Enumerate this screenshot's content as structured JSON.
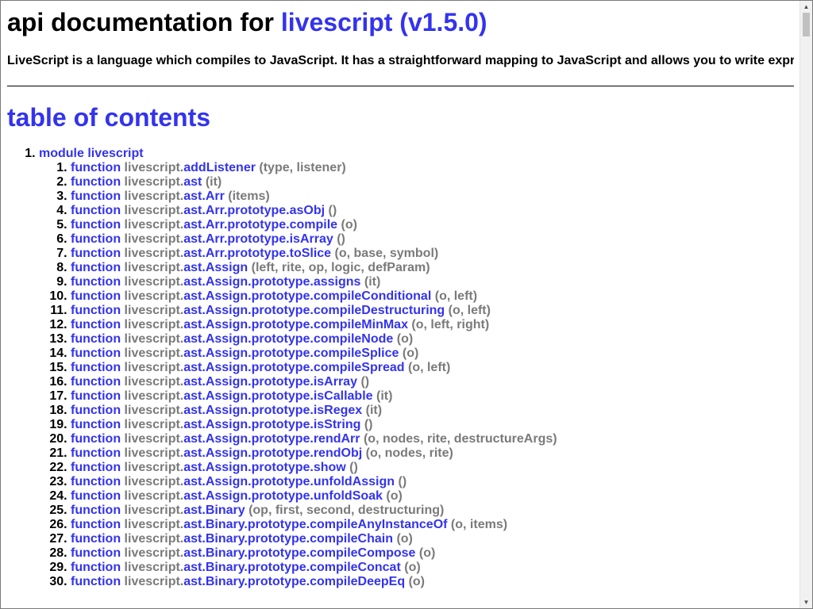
{
  "header": {
    "title_prefix": "api documentation for",
    "title_link": "livescript (v1.5.0)"
  },
  "intro": "LiveScript is a language which compiles to JavaScript. It has a straightforward mapping to JavaScript and allows you to write expressive code devoid of repetitive boilerplate. While LiveScript adds many features to assist in functional style programming,",
  "toc": {
    "heading": "table of contents",
    "module_label": "module livescript",
    "function_keyword": "function",
    "namespace": "livescript.",
    "items": [
      {
        "name": "addListener",
        "params": "(type, listener)"
      },
      {
        "name": "ast",
        "params": "(it)"
      },
      {
        "name": "ast.Arr",
        "params": "(items)"
      },
      {
        "name": "ast.Arr.prototype.asObj",
        "params": "()"
      },
      {
        "name": "ast.Arr.prototype.compile",
        "params": "(o)"
      },
      {
        "name": "ast.Arr.prototype.isArray",
        "params": "()"
      },
      {
        "name": "ast.Arr.prototype.toSlice",
        "params": "(o, base, symbol)"
      },
      {
        "name": "ast.Assign",
        "params": "(left, rite, op, logic, defParam)"
      },
      {
        "name": "ast.Assign.prototype.assigns",
        "params": "(it)"
      },
      {
        "name": "ast.Assign.prototype.compileConditional",
        "params": "(o, left)"
      },
      {
        "name": "ast.Assign.prototype.compileDestructuring",
        "params": "(o, left)"
      },
      {
        "name": "ast.Assign.prototype.compileMinMax",
        "params": "(o, left, right)"
      },
      {
        "name": "ast.Assign.prototype.compileNode",
        "params": "(o)"
      },
      {
        "name": "ast.Assign.prototype.compileSplice",
        "params": "(o)"
      },
      {
        "name": "ast.Assign.prototype.compileSpread",
        "params": "(o, left)"
      },
      {
        "name": "ast.Assign.prototype.isArray",
        "params": "()"
      },
      {
        "name": "ast.Assign.prototype.isCallable",
        "params": "(it)"
      },
      {
        "name": "ast.Assign.prototype.isRegex",
        "params": "(it)"
      },
      {
        "name": "ast.Assign.prototype.isString",
        "params": "()"
      },
      {
        "name": "ast.Assign.prototype.rendArr",
        "params": "(o, nodes, rite, destructureArgs)"
      },
      {
        "name": "ast.Assign.prototype.rendObj",
        "params": "(o, nodes, rite)"
      },
      {
        "name": "ast.Assign.prototype.show",
        "params": "()"
      },
      {
        "name": "ast.Assign.prototype.unfoldAssign",
        "params": "()"
      },
      {
        "name": "ast.Assign.prototype.unfoldSoak",
        "params": "(o)"
      },
      {
        "name": "ast.Binary",
        "params": "(op, first, second, destructuring)"
      },
      {
        "name": "ast.Binary.prototype.compileAnyInstanceOf",
        "params": "(o, items)"
      },
      {
        "name": "ast.Binary.prototype.compileChain",
        "params": "(o)"
      },
      {
        "name": "ast.Binary.prototype.compileCompose",
        "params": "(o)"
      },
      {
        "name": "ast.Binary.prototype.compileConcat",
        "params": "(o)"
      },
      {
        "name": "ast.Binary.prototype.compileDeepEq",
        "params": "(o)"
      }
    ]
  },
  "colors": {
    "link": "#3333ee",
    "muted": "#7a7a7a",
    "text": "#000000"
  },
  "scrollbar": {
    "up_icon": "triangle-up",
    "down_icon": "triangle-down"
  }
}
